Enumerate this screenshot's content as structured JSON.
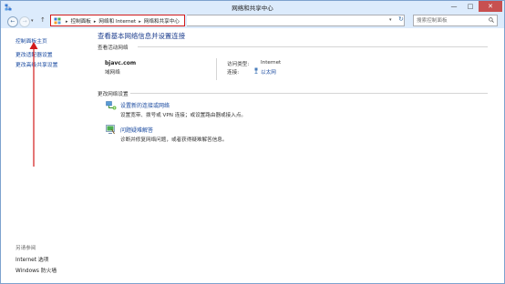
{
  "window": {
    "title": "网络和共享中心",
    "minimize_glyph": "—",
    "maximize_glyph": "□",
    "close_glyph": "✕"
  },
  "nav": {
    "back_glyph": "←",
    "forward_glyph": "→",
    "dropdown_glyph": "▾",
    "up_glyph": "↑",
    "refresh_glyph": "↻",
    "breadcrumb": [
      "控制面板",
      "网络和 Internet",
      "网络和共享中心"
    ],
    "breadcrumb_sep": "▸",
    "search_placeholder": "搜索控制面板",
    "highlight_color": "#d21b1b"
  },
  "sidebar": {
    "home": "控制面板主页",
    "links": [
      "更改适配器设置",
      "更改高级共享设置"
    ],
    "see_also_title": "另请参阅",
    "see_also": [
      "Internet 选项",
      "Windows 防火墙"
    ]
  },
  "main": {
    "heading": "查看基本网络信息并设置连接",
    "active_networks_title": "查看活动网络",
    "network": {
      "name": "bjavc.com",
      "type": "域网络",
      "access_type_label": "访问类型:",
      "access_type_value": "Internet",
      "connections_label": "连接:",
      "connections_value": "以太网"
    },
    "change_settings_title": "更改网络设置",
    "tasks": [
      {
        "link": "设置新的连接或网络",
        "desc": "设置宽带、拨号或 VPN 连接；或设置路由器或接入点。",
        "icon": "network-setup-icon"
      },
      {
        "link": "问题疑难解答",
        "desc": "诊断并修复网络问题，或者获得疑难解答信息。",
        "icon": "troubleshoot-icon"
      }
    ]
  },
  "colors": {
    "accent": "#1a4aa0",
    "annotation": "#d21b1b",
    "titlebar": "#dcebfc",
    "close_button": "#c75050"
  }
}
